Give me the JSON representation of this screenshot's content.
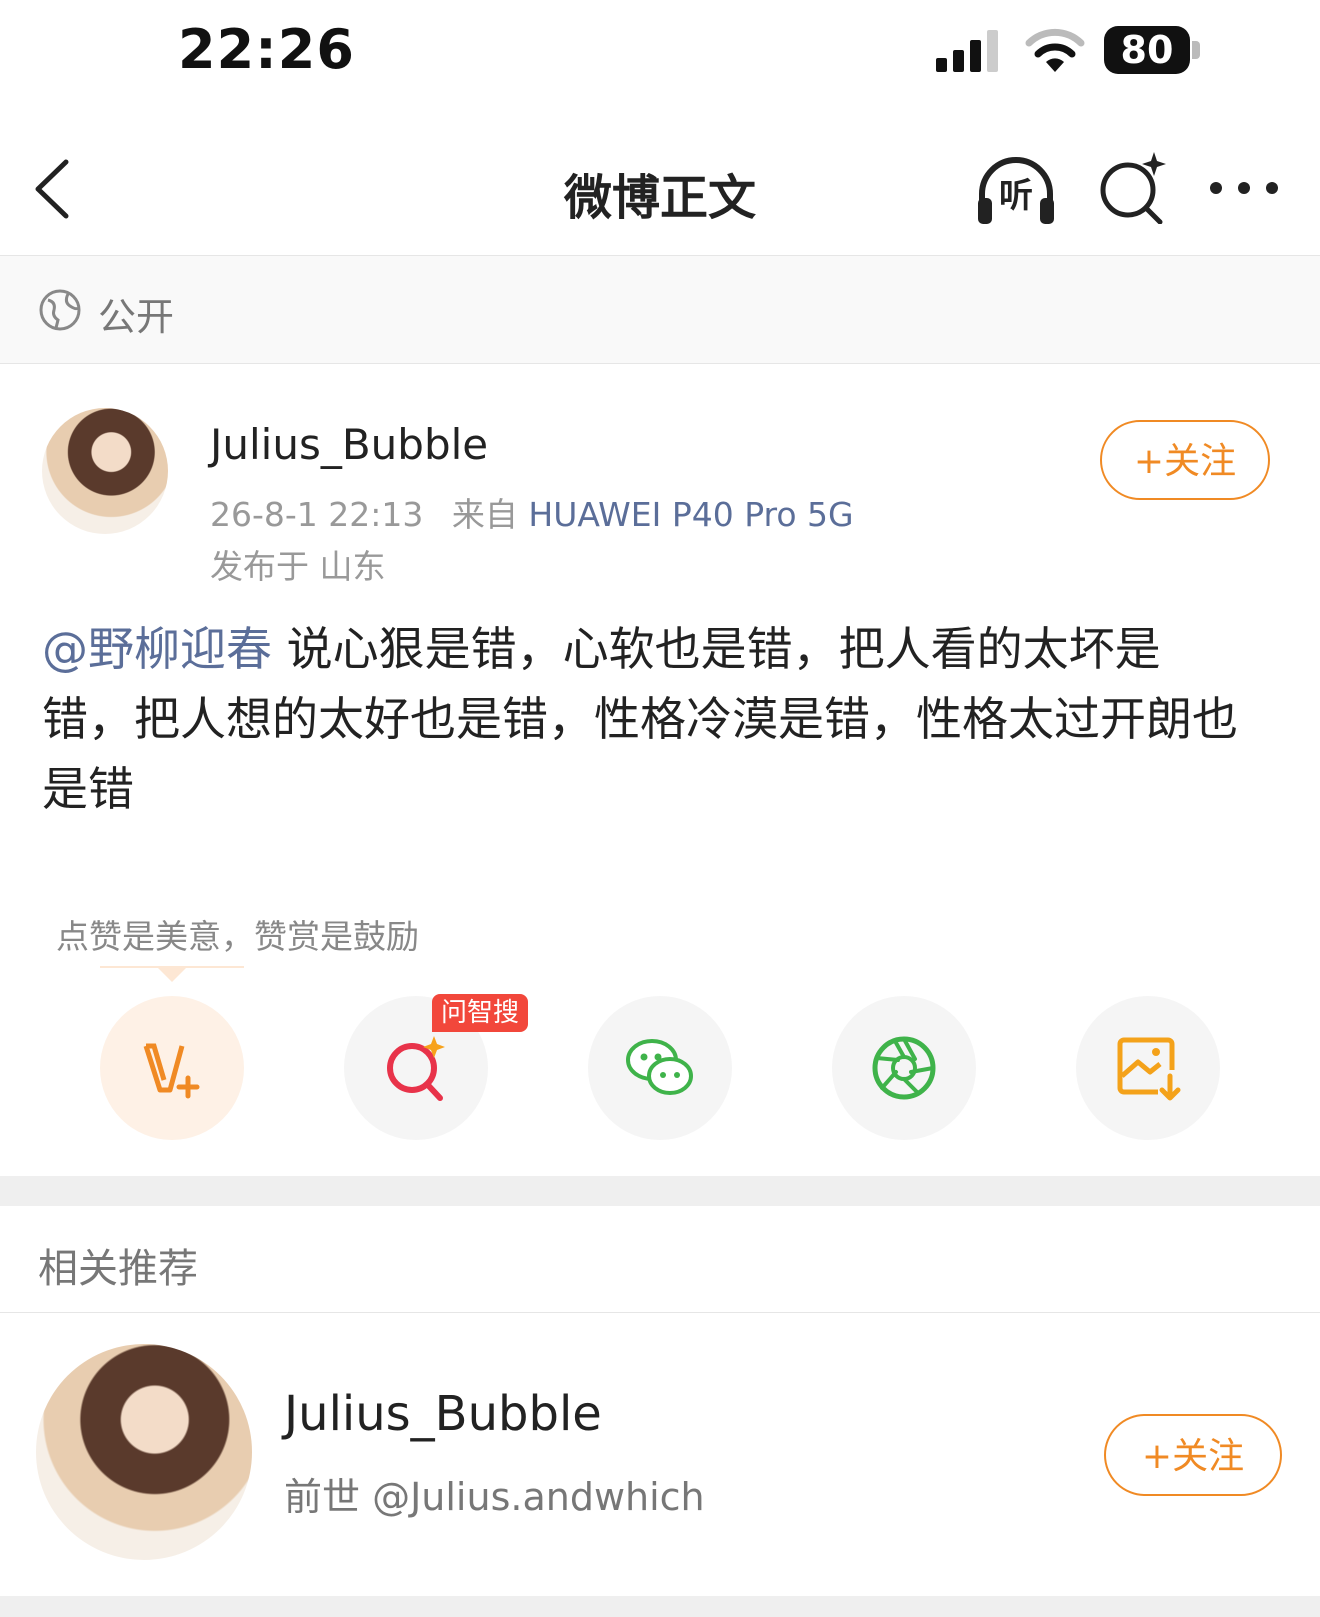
{
  "status_bar": {
    "time": "22:26",
    "battery": "80"
  },
  "nav": {
    "title": "微博正文",
    "listen_label": "听"
  },
  "visibility": {
    "label": "公开"
  },
  "post": {
    "author": "Julius_Bubble",
    "time": "26-8-1 22:13",
    "from_prefix": "来自",
    "device": "HUAWEI P40 Pro 5G",
    "location": "发布于 山东",
    "follow_label": "+关注",
    "mention": "@野柳迎春",
    "text": "说心狠是错，心软也是错，把人看的太坏是错，把人想的太好也是错，性格冷漠是错，性格太过开朗也是错"
  },
  "reward_tip": "点赞是美意，赞赏是鼓励",
  "actions": {
    "search_badge": "问智搜"
  },
  "related": {
    "title": "相关推荐",
    "user": {
      "name": "Julius_Bubble",
      "subtitle": "前世 @Julius.andwhich",
      "follow_label": "+关注"
    }
  },
  "colors": {
    "accent": "#f08a24",
    "link": "#5b6e99",
    "badge": "#f2473b",
    "green": "#3fb34a"
  }
}
